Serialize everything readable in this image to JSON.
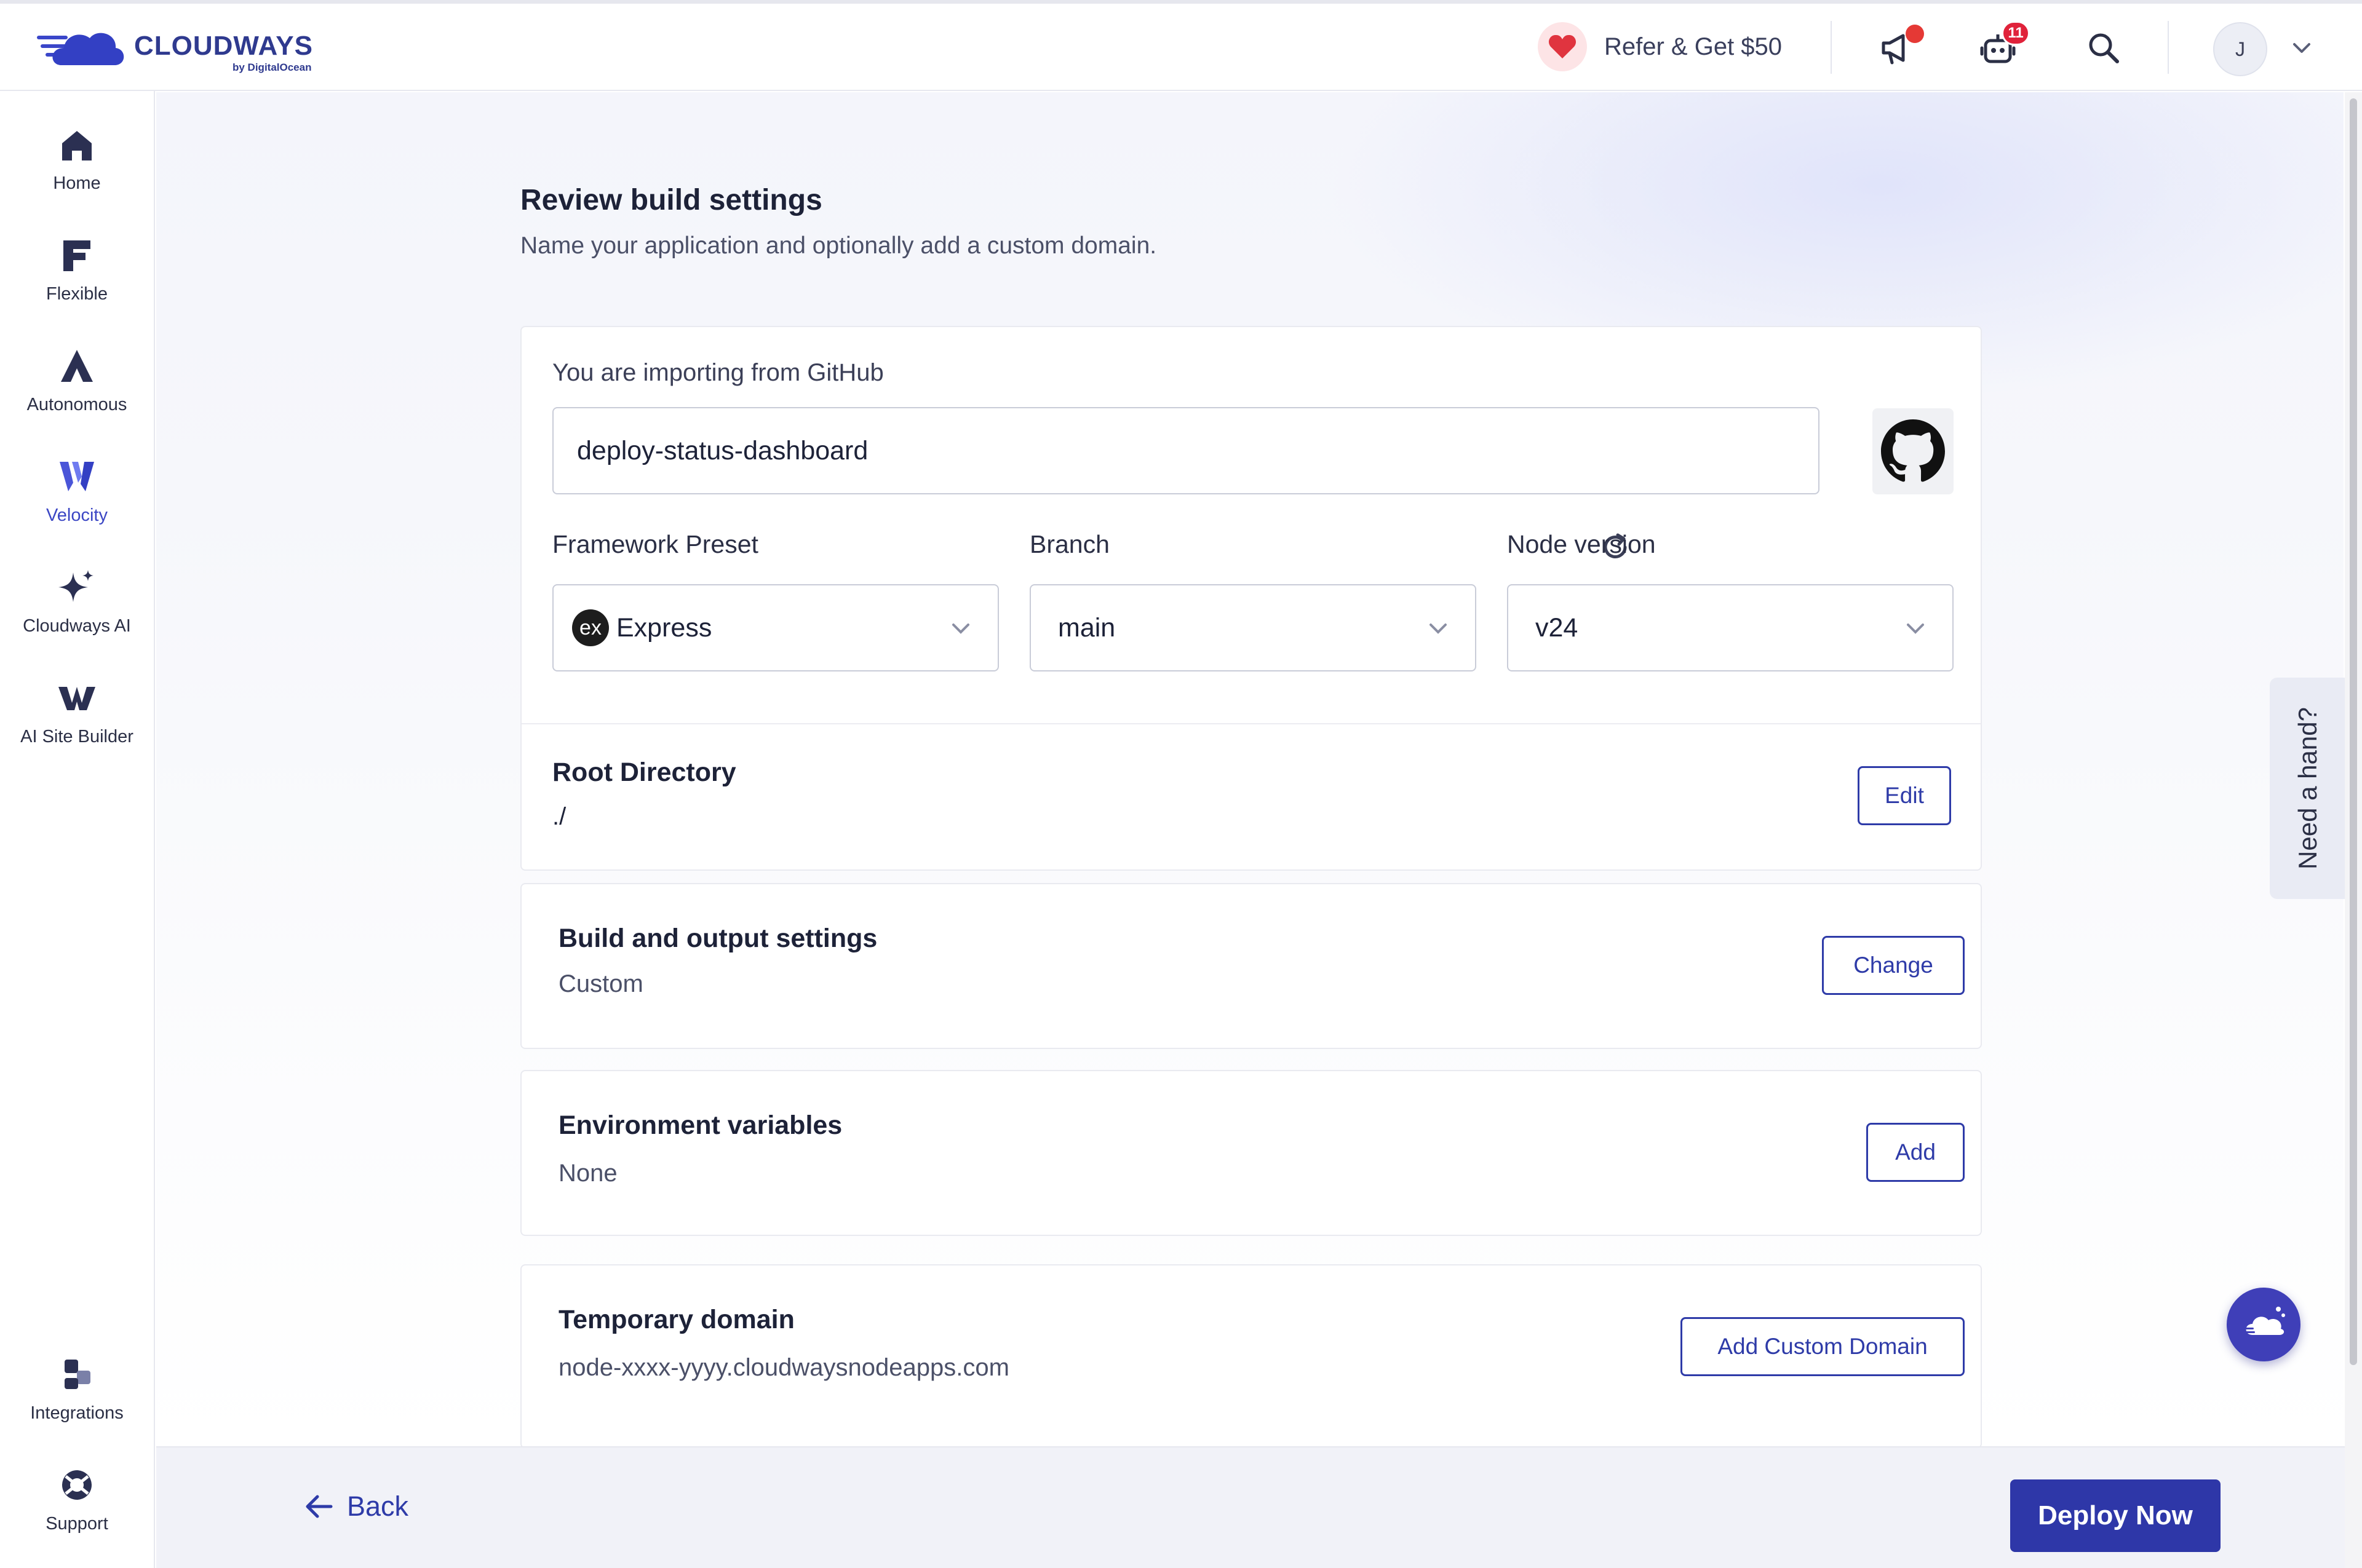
{
  "brand": {
    "name": "CLOUDWAYS",
    "sub": "by DigitalOcean",
    "color": "#2f3a8f"
  },
  "topbar": {
    "refer_label": "Refer & Get $50",
    "robot_badge": "11",
    "avatar_initial": "J"
  },
  "sidebar": {
    "items": [
      {
        "label": "Home",
        "icon": "home-icon"
      },
      {
        "label": "Flexible",
        "icon": "flexible-icon"
      },
      {
        "label": "Autonomous",
        "icon": "autonomous-icon"
      },
      {
        "label": "Velocity",
        "icon": "velocity-icon",
        "active": true
      },
      {
        "label": "Cloudways AI",
        "icon": "sparkle-icon"
      },
      {
        "label": "AI Site Builder",
        "icon": "w-logo-icon"
      },
      {
        "label": "Integrations",
        "icon": "integrations-icon"
      },
      {
        "label": "Support",
        "icon": "support-icon"
      }
    ]
  },
  "page": {
    "title": "Review build settings",
    "subtitle": "Name your application and optionally add a custom domain."
  },
  "import": {
    "label": "You are importing from GitHub",
    "repo_value": "deploy-status-dashboard",
    "framework": {
      "label": "Framework Preset",
      "badge": "ex",
      "value": "Express"
    },
    "branch": {
      "label": "Branch",
      "value": "main"
    },
    "node": {
      "label": "Node version",
      "value": "v24"
    }
  },
  "root_dir": {
    "title": "Root Directory",
    "value": "./",
    "button": "Edit"
  },
  "build": {
    "title": "Build and output settings",
    "value": "Custom",
    "button": "Change"
  },
  "env": {
    "title": "Environment variables",
    "value": "None",
    "button": "Add"
  },
  "domain": {
    "title": "Temporary domain",
    "value": "node-xxxx-yyyy.cloudwaysnodeapps.com",
    "button": "Add Custom Domain"
  },
  "help": {
    "label": "Need a hand?"
  },
  "footer": {
    "back_label": "Back",
    "deploy_label": "Deploy Now"
  },
  "colors": {
    "accent": "#2e3ba8",
    "deploy": "#2e37a8",
    "alert": "#e53935",
    "active_nav": "#3b46c4"
  }
}
